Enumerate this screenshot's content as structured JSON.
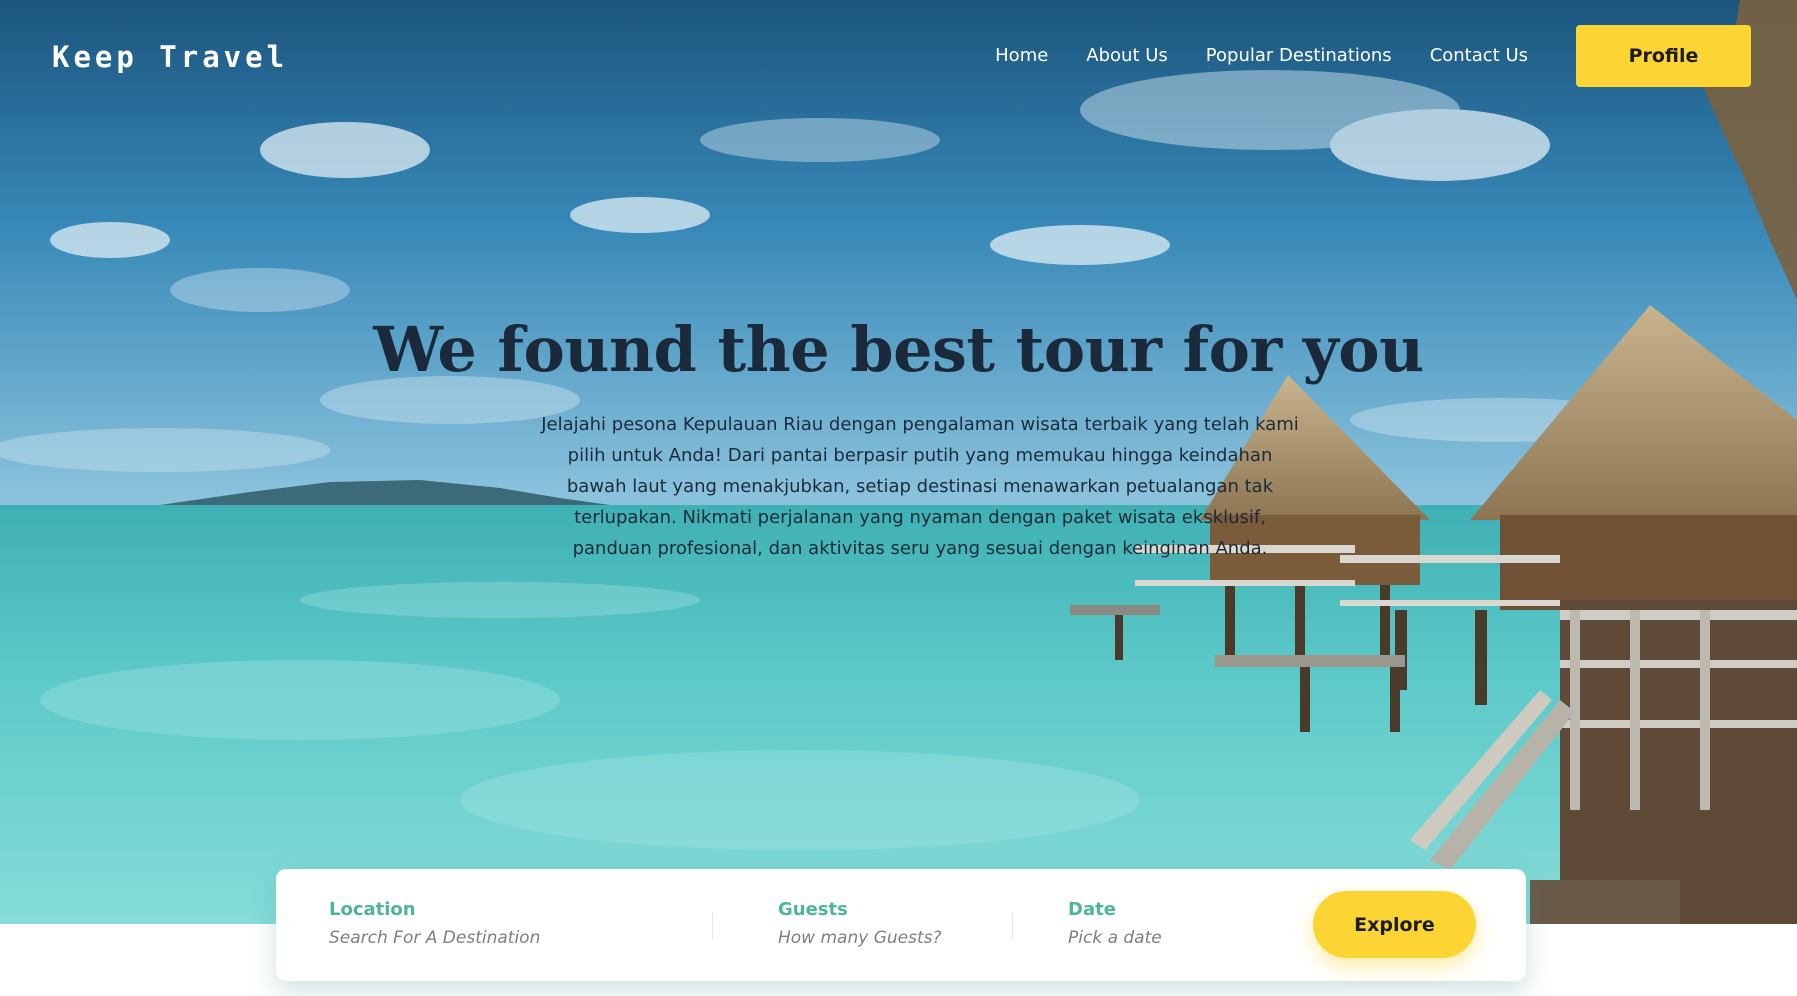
{
  "header": {
    "logo": "Keep Travel",
    "nav": [
      "Home",
      "About Us",
      "Popular Destinations",
      "Contact Us"
    ],
    "profile_label": "Profile"
  },
  "hero": {
    "title": "We found the best tour for you",
    "description": "Jelajahi pesona Kepulauan Riau dengan pengalaman wisata terbaik yang telah kami pilih untuk Anda! Dari pantai berpasir putih yang memukau hingga keindahan bawah laut yang menakjubkan, setiap destinasi menawarkan petualangan tak terlupakan. Nikmati perjalanan yang nyaman dengan paket wisata eksklusif, panduan profesional, dan aktivitas seru yang sesuai dengan keinginan Anda."
  },
  "search": {
    "location": {
      "label": "Location",
      "placeholder": "Search For A Destination"
    },
    "guests": {
      "label": "Guests",
      "placeholder": "How many Guests?"
    },
    "date": {
      "label": "Date",
      "placeholder": "Pick a date"
    },
    "explore_label": "Explore"
  },
  "colors": {
    "accent": "#fcd535",
    "field_label": "#4db59a",
    "title": "#1a2a3a"
  }
}
